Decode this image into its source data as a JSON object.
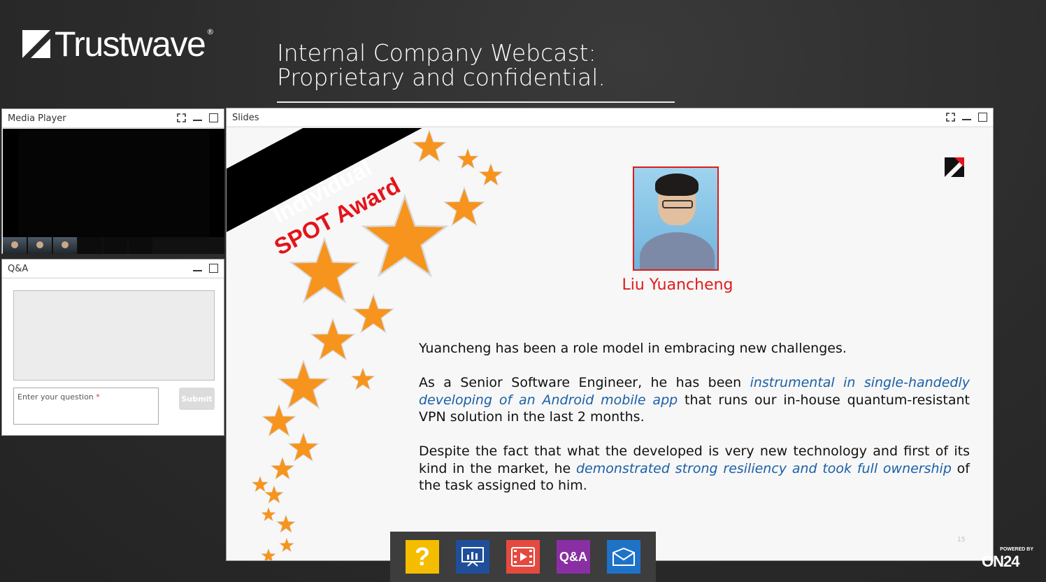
{
  "brand": {
    "name": "Trustwave",
    "reg": "®"
  },
  "header": {
    "title_line1": "Internal Company Webcast:",
    "title_line2": "Proprietary and confidential."
  },
  "media_player": {
    "title": "Media Player"
  },
  "qa_panel": {
    "title": "Q&A",
    "input_placeholder": "Enter your question",
    "required_mark": "*",
    "submit_label": "Submit"
  },
  "slides_panel": {
    "title": "Slides"
  },
  "slide": {
    "award_line1": "Individual",
    "award_line2": "SPOT Award",
    "person_name": "Liu Yuancheng",
    "p1": "Yuancheng has been a role model in embracing new challenges.",
    "p2_a": "As a Senior Software Engineer, he has been ",
    "p2_hl": "instrumental in single-handedly developing of an Android mobile app",
    "p2_b": " that runs our in-house quantum-resistant VPN solution in the last 2 months.",
    "p3_a": "Despite the fact that what the developed is very new technology and first of its kind in the market, he ",
    "p3_hl": "demonstrated strong resiliency and took full ownership",
    "p3_b": " of the task assigned to him.",
    "page_number": "15"
  },
  "dock": {
    "help": "?",
    "qa": "Q&A"
  },
  "powered": {
    "small": "POWERED BY",
    "big": "ON24"
  },
  "colors": {
    "accent_red": "#e01b1b",
    "highlight_blue": "#1a5fa8",
    "star_orange": "#f7941d"
  }
}
